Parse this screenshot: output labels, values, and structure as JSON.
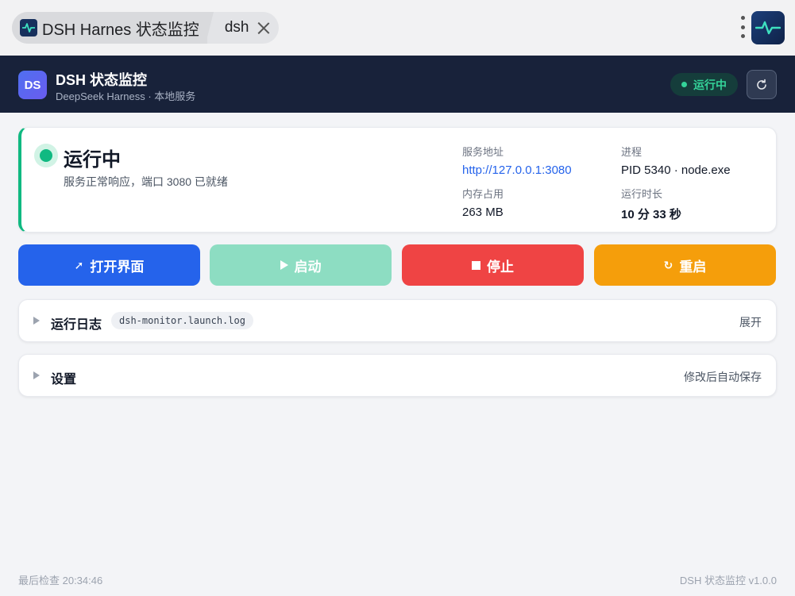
{
  "tabs": {
    "main_title": "DSH Harnes 状态监控",
    "sub_label": "dsh"
  },
  "header": {
    "logo_text": "DS",
    "title": "DSH 状态监控",
    "subtitle": "DeepSeek Harness · 本地服务",
    "status": "运行中"
  },
  "status_card": {
    "title": "运行中",
    "description": "服务正常响应，端口 3080 已就绪",
    "info": {
      "address_label": "服务地址",
      "address_value": "http://127.0.0.1:3080",
      "process_label": "进程",
      "process_value": "PID 5340 · node.exe",
      "memory_label": "内存占用",
      "memory_value": "263 MB",
      "uptime_label": "运行时长",
      "uptime_value": "10 分 33 秒"
    }
  },
  "actions": {
    "open": "打开界面",
    "start": "启动",
    "stop": "停止",
    "restart": "重启"
  },
  "log_section": {
    "title": "运行日志",
    "file": "dsh-monitor.launch.log",
    "toggle": "展开"
  },
  "settings_section": {
    "title": "设置",
    "note": "修改后自动保存"
  },
  "footer": {
    "last_check": "最后检查 20:34:46",
    "version": "DSH 状态监控 v1.0.0"
  },
  "colors": {
    "accent_blue": "#2563eb",
    "success": "#10b981",
    "danger": "#ef4444",
    "warning": "#f59e0b",
    "header_bg": "#18223a"
  }
}
